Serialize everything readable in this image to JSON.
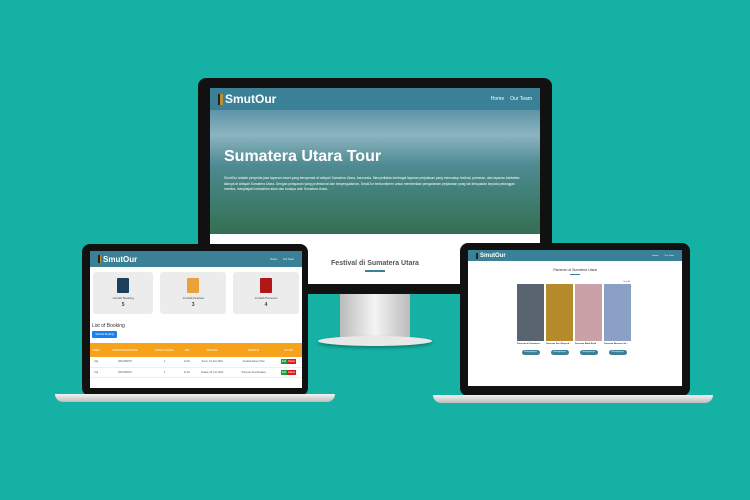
{
  "brand": "SmutOur",
  "nav": {
    "home": "Home",
    "team": "Our Team"
  },
  "hero": {
    "title": "Sumatera Utara Tour",
    "text": "SmutOur adalah penyedia jasa layanan travel yang beroperasi di wilayah Sumatera Utara, Indonesia. Menyediakan berbagai layanan perjalanan yang mencakup festival, pameran, dan layanan berkaitan lainnya di wilayah Sumatera Utara. Dengan pelayanan yang profesional dan berpengalaman, SmutOur berkomitmen untuk memberikan pengalaman perjalanan yang tak terlupakan kepada pelanggan mereka, menjelajahi keindahan alam dan budaya unik Sumatera Utara."
  },
  "festival_heading": "Festival di Sumatera Utara",
  "admin": {
    "stats": [
      {
        "label": "Jumlah Booking",
        "value": "5",
        "color": "#1d3e5c"
      },
      {
        "label": "Jumlah Festival",
        "value": "3",
        "color": "#eaa23a"
      },
      {
        "label": "Jumlah Pameran",
        "value": "4",
        "color": "#b01818"
      }
    ],
    "list_title": "List of Booking",
    "add_button": "Tambah Booking",
    "columns": [
      "NAMA",
      "NOMOR HANDPHONE",
      "JUMLAH ORANG",
      "JAM",
      "TANGGAL",
      "EVENT ID",
      "ACTION"
    ],
    "rows": [
      [
        "Apji",
        "0812345678",
        "1",
        "10.00",
        "Senin, 01 Juni 2023",
        "Festival Danau Toba"
      ],
      [
        "Fiqi",
        "0812345678",
        "4",
        "11.00",
        "Selasa, 02 Juni 2023",
        "Pameran Seni Budaya"
      ]
    ],
    "edit": "Edit",
    "delete": "Delete"
  },
  "pameran": {
    "heading": "Pameran di Sumatera Utara",
    "view_all": "Lihat All",
    "cards": [
      {
        "title": "Pameran di Sumatera...",
        "color": "#5a6470"
      },
      {
        "title": "Pameran Seni Rupa di...",
        "color": "#b58a2a"
      },
      {
        "title": "Pameran Batik Etnik",
        "color": "#c9a2a8"
      },
      {
        "title": "Pameran Museum Su...",
        "color": "#8aa0c4"
      }
    ],
    "button": "Selengkapnya"
  }
}
